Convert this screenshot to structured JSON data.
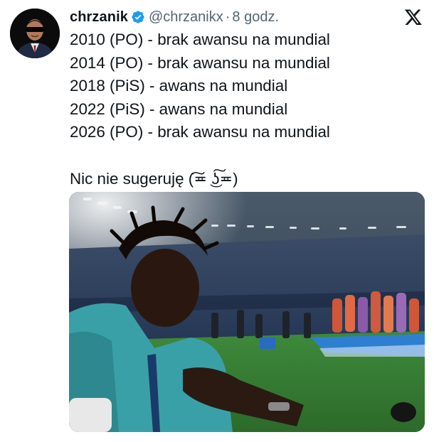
{
  "author": {
    "name": "chrzanik",
    "handle": "@chrzanikx",
    "separator": "·",
    "time": "8 godz.",
    "verified": true,
    "avatar_icon": "avatar-man-in-suit-sunglasses"
  },
  "platform_icon": "x-logo-icon",
  "tweet": {
    "lines": [
      "2010 (PO) - brak awansu na mundial",
      "2014 (PO) - brak awansu na mundial",
      "2018 (PiS) - awans na mundial",
      "2022 (PiS) - awans na mundial",
      "2026 (PO) - brak awansu na mundial"
    ],
    "closing": "Nic nie sugeruję (͠≖ ͜ʖ͠≖)"
  },
  "media": {
    "type": "video-still",
    "icon": "stadium-photo"
  },
  "colors": {
    "verified_blue": "#1d9bf0",
    "secondary_text": "#536471",
    "primary_text": "#0f1419"
  }
}
